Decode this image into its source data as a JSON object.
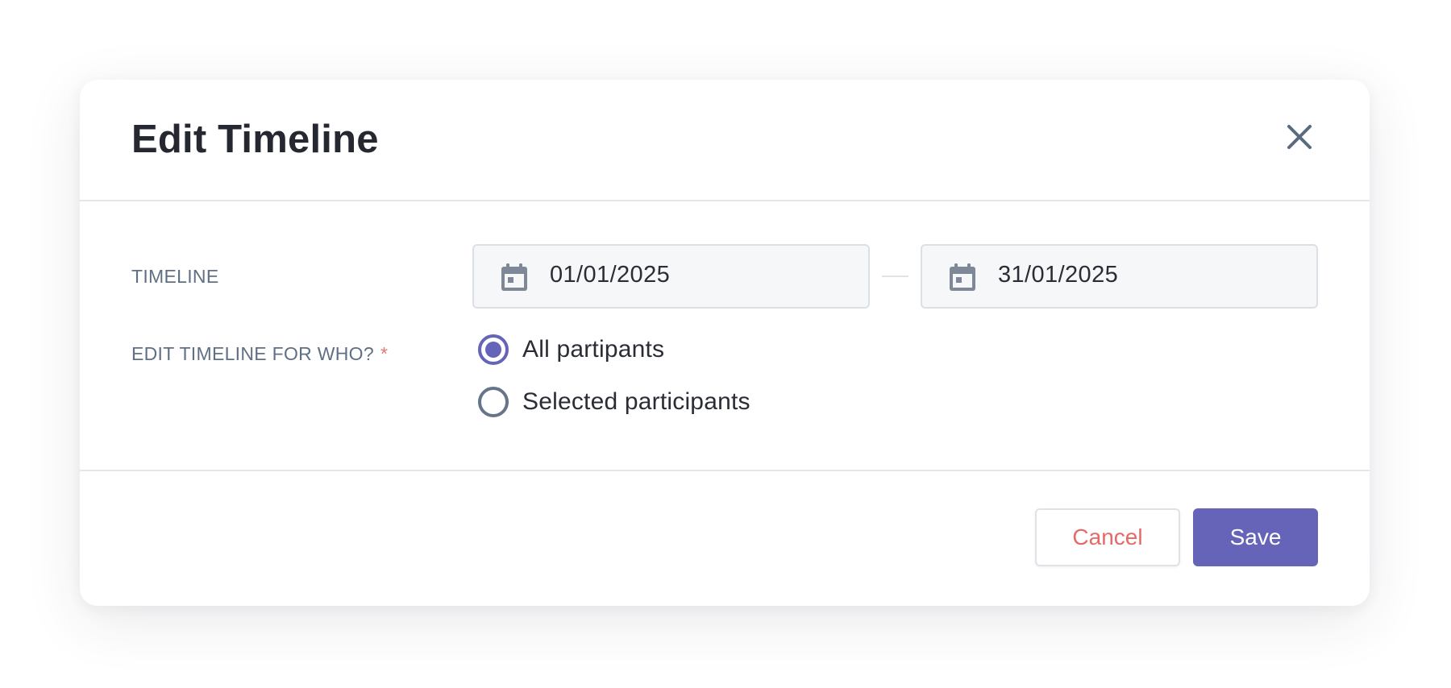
{
  "modal": {
    "title": "Edit Timeline"
  },
  "timeline": {
    "label": "TIMELINE",
    "start_date": "01/01/2025",
    "end_date": "31/01/2025",
    "icon": "calendar-icon"
  },
  "audience": {
    "label": "EDIT TIMELINE FOR WHO?",
    "required_marker": "*",
    "options": [
      {
        "label": "All partipants",
        "selected": true
      },
      {
        "label": "Selected participants",
        "selected": false
      }
    ]
  },
  "footer": {
    "cancel_label": "Cancel",
    "save_label": "Save"
  },
  "colors": {
    "accent": "#6664b8",
    "danger": "#e46a68",
    "label": "#5f6f84",
    "required": "#e8756e"
  }
}
